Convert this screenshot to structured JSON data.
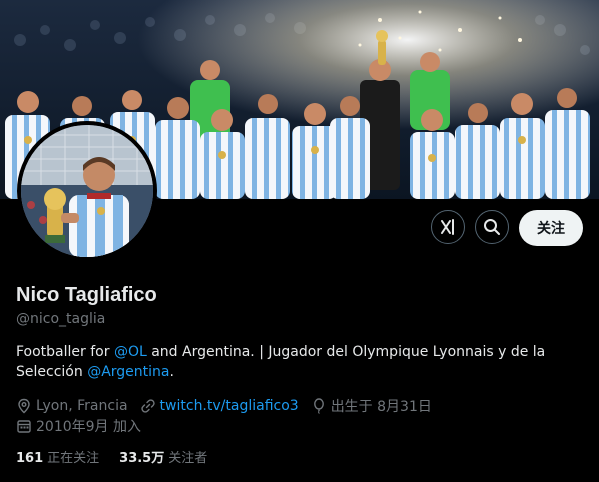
{
  "profile": {
    "name": "Nico Tagliafico",
    "handle": "@nico_taglia",
    "bio_prefix": "Footballer for ",
    "bio_link1": "@OL",
    "bio_middle": " and Argentina. | Jugador del Olympique Lyonnais y de la Selección ",
    "bio_link2": "@Argentina",
    "bio_suffix": "."
  },
  "meta": {
    "location": "Lyon, Francia",
    "website": "twitch.tv/tagliafico3",
    "birthday": "出生于 8月31日",
    "joined": "2010年9月 加入"
  },
  "stats": {
    "following_count": "161",
    "following_label": "正在关注",
    "followers_count": "33.5万",
    "followers_label": "关注者"
  },
  "actions": {
    "follow_label": "关注"
  },
  "colors": {
    "background": "#000000",
    "link": "#1d9bf0",
    "muted": "#71767b",
    "argentina_blue": "#74acdf"
  }
}
